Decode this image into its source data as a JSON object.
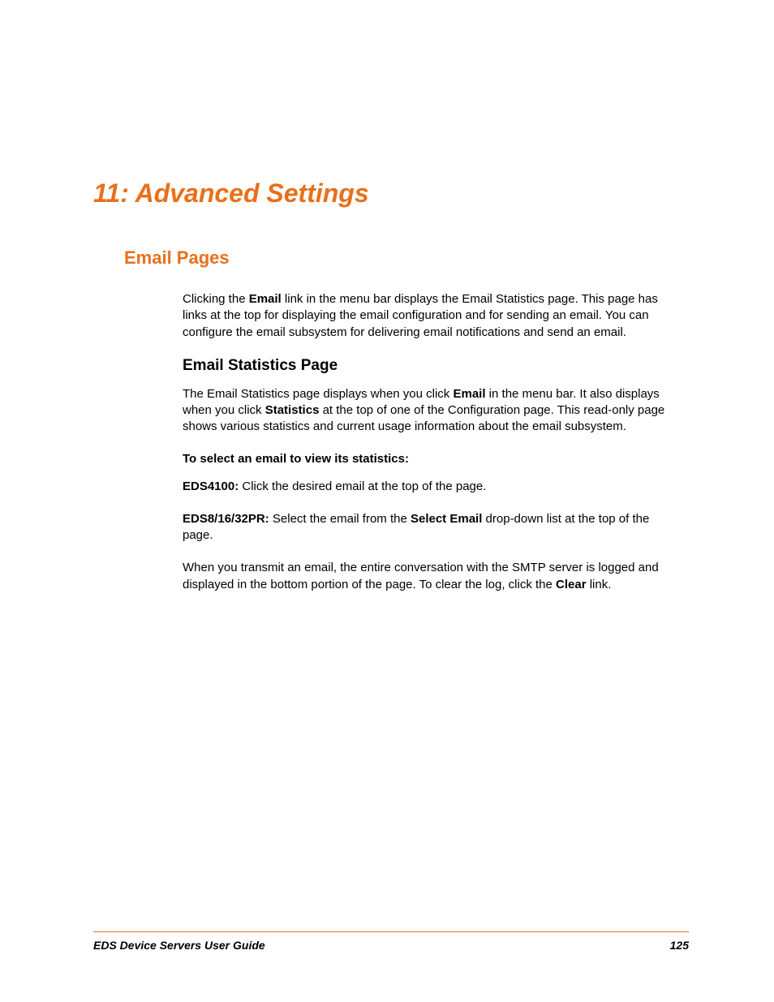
{
  "chapter": {
    "number": "11:",
    "title": "Advanced Settings"
  },
  "section1": {
    "heading": "Email Pages",
    "intro": {
      "part1": "Clicking the ",
      "bold1": "Email",
      "part2": " link in the menu bar displays the Email Statistics page. This page has links at the top for displaying the email configuration and for sending an email. You can configure the email subsystem for delivering email notifications and send an email."
    }
  },
  "subsection1": {
    "heading": "Email Statistics Page",
    "para1": {
      "part1": "The Email Statistics page displays when you click ",
      "bold1": "Email",
      "part2": " in the menu bar. It also displays when you click ",
      "bold2": "Statistics",
      "part3": " at the top of one of the Configuration page. This read-only page shows various statistics and current usage information about the email subsystem."
    },
    "instruction": "To select an email to view its statistics:",
    "eds4100": {
      "label": "EDS4100:",
      "text": " Click the desired email at the top of the page."
    },
    "eds81632": {
      "label": "EDS8/16/32PR:",
      "part1": " Select the email from the ",
      "bold1": "Select Email",
      "part2": " drop-down list at the top of the page."
    },
    "para2": {
      "part1": "When you transmit an email, the entire conversation with the SMTP server is logged and displayed in the bottom portion of the page. To clear the log, click the ",
      "bold1": "Clear",
      "part2": " link."
    }
  },
  "footer": {
    "title": "EDS Device Servers User Guide",
    "page": "125"
  }
}
